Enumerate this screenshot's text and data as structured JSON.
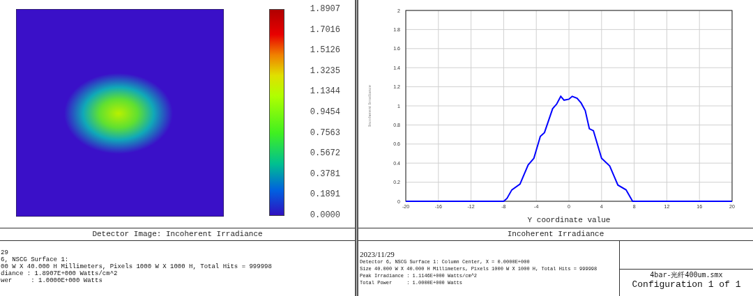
{
  "left_panel": {
    "colorbar": {
      "labels": [
        "1.8907",
        "1.7016",
        "1.5126",
        "1.3235",
        "1.1344",
        "0.9454",
        "0.7563",
        "0.5672",
        "0.3781",
        "0.1891",
        "0.0000"
      ]
    },
    "title": "Detector Image: Incoherent Irradiance",
    "info_lines": [
      "29",
      "6, NSCG Surface 1:",
      "00 W X 40.000 H Millimeters, Pixels 1000 W X 1000 H, Total Hits = 999998",
      "diance : 1.8907E+000 Watts/cm^2",
      "wer     : 1.0000E+000 Watts"
    ]
  },
  "right_panel": {
    "chart_data": {
      "type": "line",
      "xlabel": "Y coordinate value",
      "ylabel": "Incoherent Irradiance",
      "x": [
        -20,
        -8,
        -7.6,
        -7,
        -6,
        -5,
        -4.3,
        -3.5,
        -3,
        -2,
        -1.5,
        -1,
        -0.6,
        0,
        0.4,
        1,
        1.5,
        2,
        2.5,
        3,
        4,
        5,
        6,
        7,
        7.8,
        20
      ],
      "series": [
        {
          "color": "#0000ff",
          "values": [
            0,
            0,
            0.03,
            0.12,
            0.18,
            0.38,
            0.45,
            0.68,
            0.72,
            0.97,
            1.02,
            1.1,
            1.06,
            1.07,
            1.1,
            1.08,
            1.03,
            0.95,
            0.76,
            0.74,
            0.45,
            0.37,
            0.17,
            0.12,
            0,
            0
          ]
        }
      ],
      "grid": true,
      "xlim": [
        -20,
        20
      ],
      "ylim": [
        0,
        2
      ],
      "xticks": [
        -20,
        -16,
        -12,
        -8,
        -4,
        0,
        4,
        8,
        12,
        16,
        20
      ],
      "yticks": [
        0,
        0.2,
        0.4,
        0.6,
        0.8,
        1,
        1.2,
        1.4,
        1.6,
        1.8,
        2
      ]
    },
    "title": "Incoherent Irradiance",
    "date": "2023/11/29",
    "info_lines": [
      "Detector 6, NSCG Surface 1: Column Center, X = 0.0000E+000",
      "Size 40.000 W X 40.000 H Millimeters, Pixels 1000 W X 1000 H, Total Hits = 999998",
      "Peak Irradiance : 1.1146E+000 Watts/cm^2",
      "Total Power     : 1.0000E+000 Watts"
    ],
    "file_name": "4bar-光纤400um.smx",
    "configuration": "Configuration 1 of 1"
  }
}
